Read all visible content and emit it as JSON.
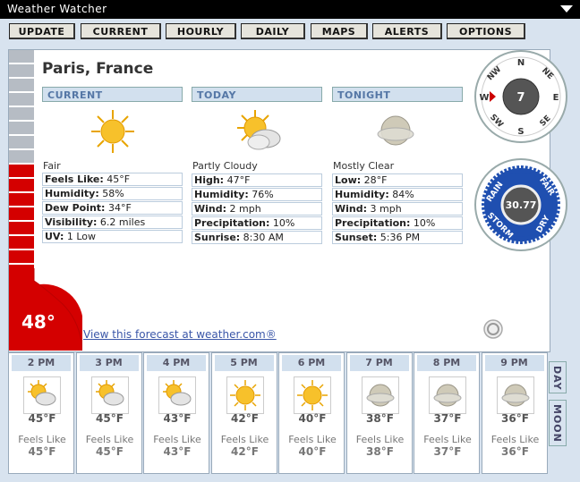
{
  "window": {
    "title": "Weather Watcher"
  },
  "toolbar": {
    "buttons": [
      "UPDATE",
      "CURRENT",
      "HOURLY",
      "DAILY",
      "MAPS",
      "ALERTS",
      "OPTIONS"
    ]
  },
  "location": "Paris, France",
  "current_temp": "48°",
  "current": {
    "header": "CURRENT",
    "icon": "sunny-icon",
    "condition": "Fair",
    "rows": [
      {
        "label": "Feels Like:",
        "value": " 45°F"
      },
      {
        "label": "Humidity:",
        "value": " 58%"
      },
      {
        "label": "Dew Point:",
        "value": " 34°F"
      },
      {
        "label": "Visibility:",
        "value": " 6.2 miles"
      },
      {
        "label": "UV:",
        "value": " 1 Low"
      }
    ]
  },
  "today": {
    "header": "TODAY",
    "icon": "partly-cloudy-icon",
    "condition": "Partly Cloudy",
    "rows": [
      {
        "label": "High:",
        "value": " 47°F"
      },
      {
        "label": "Humidity:",
        "value": "  76%"
      },
      {
        "label": "Wind:",
        "value": "  2 mph"
      },
      {
        "label": "Precipitation:",
        "value": "  10%"
      },
      {
        "label": "Sunrise:",
        "value": " 8:30 AM"
      }
    ]
  },
  "tonight": {
    "header": "TONIGHT",
    "icon": "mostly-clear-night-icon",
    "condition": "Mostly Clear",
    "rows": [
      {
        "label": "Low:",
        "value": " 28°F"
      },
      {
        "label": "Humidity:",
        "value": "  84%"
      },
      {
        "label": "Wind:",
        "value": "  3 mph"
      },
      {
        "label": "Precipitation:",
        "value": "  10%"
      },
      {
        "label": "Sunset:",
        "value": " 5:36 PM"
      }
    ]
  },
  "link_text": "View this forecast at weather.com®",
  "compass": {
    "labels": [
      "N",
      "NE",
      "E",
      "SE",
      "S",
      "SW",
      "W",
      "NW"
    ],
    "wind_dir": "W",
    "speed": "7"
  },
  "barometer": {
    "value": "30.77",
    "labels": [
      "RAIN",
      "FAIR",
      "STORM",
      "DRY"
    ]
  },
  "side_tabs": [
    "DAY",
    "MOON"
  ],
  "hourly": [
    {
      "time": "2 PM",
      "icon": "partly-cloudy-icon",
      "temp": "45°F",
      "feels_label": "Feels Like",
      "feels": "45°F"
    },
    {
      "time": "3 PM",
      "icon": "partly-cloudy-icon",
      "temp": "45°F",
      "feels_label": "Feels Like",
      "feels": "45°F"
    },
    {
      "time": "4 PM",
      "icon": "partly-cloudy-icon",
      "temp": "43°F",
      "feels_label": "Feels Like",
      "feels": "43°F"
    },
    {
      "time": "5 PM",
      "icon": "sunny-icon",
      "temp": "42°F",
      "feels_label": "Feels Like",
      "feels": "42°F"
    },
    {
      "time": "6 PM",
      "icon": "sunny-icon",
      "temp": "40°F",
      "feels_label": "Feels Like",
      "feels": "40°F"
    },
    {
      "time": "7 PM",
      "icon": "clear-night-icon",
      "temp": "38°F",
      "feels_label": "Feels Like",
      "feels": "38°F"
    },
    {
      "time": "8 PM",
      "icon": "clear-night-icon",
      "temp": "37°F",
      "feels_label": "Feels Like",
      "feels": "37°F"
    },
    {
      "time": "9 PM",
      "icon": "clear-night-icon",
      "temp": "36°F",
      "feels_label": "Feels Like",
      "feels": "36°F"
    }
  ],
  "colors": {
    "accent": "#d40000",
    "header_bg": "#d2e0ee",
    "link": "#3a56a8"
  }
}
